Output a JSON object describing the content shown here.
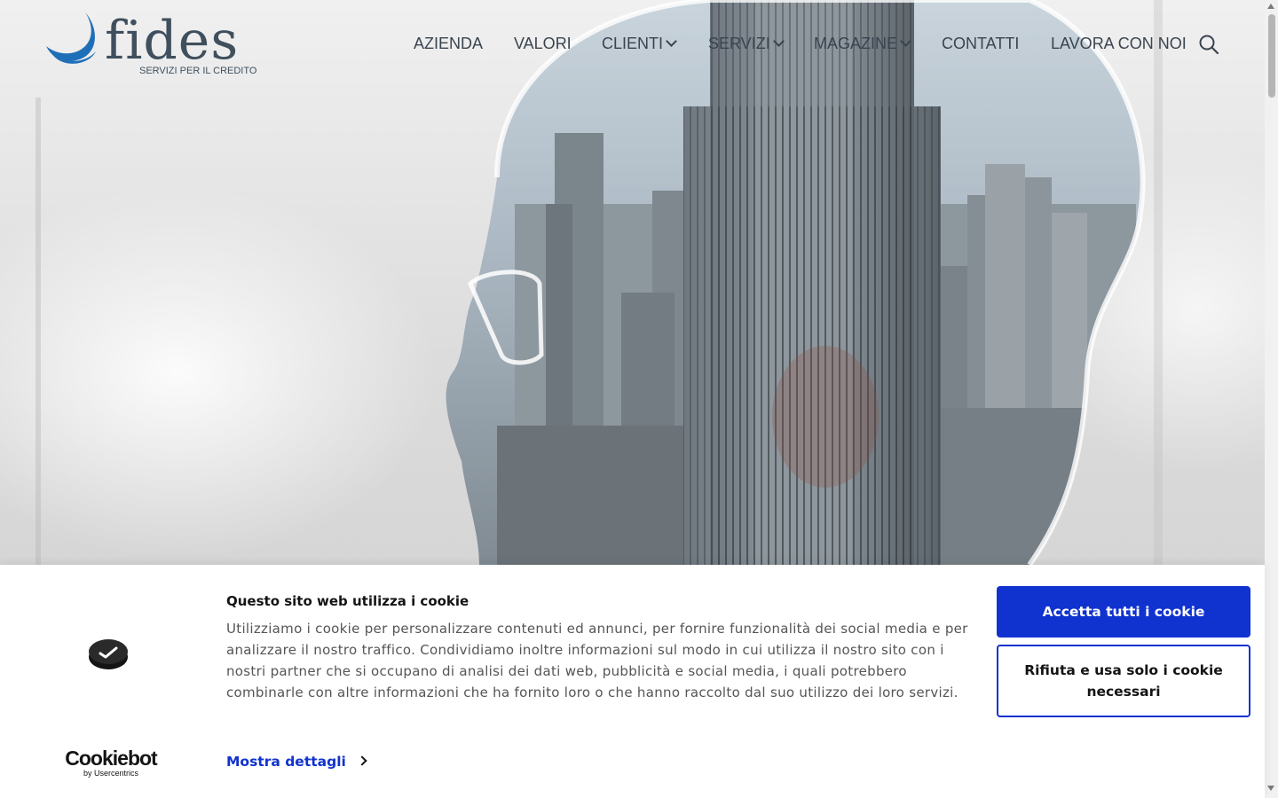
{
  "logo": {
    "word": "fides",
    "tagline": "SERVIZI PER IL CREDITO"
  },
  "nav": {
    "items": [
      {
        "label": "AZIENDA",
        "dropdown": false
      },
      {
        "label": "VALORI",
        "dropdown": false
      },
      {
        "label": "CLIENTI",
        "dropdown": true
      },
      {
        "label": "SERVIZI",
        "dropdown": true
      },
      {
        "label": "MAGAZINE",
        "dropdown": true
      },
      {
        "label": "CONTATTI",
        "dropdown": false
      },
      {
        "label": "LAVORA CON NOI",
        "dropdown": false
      }
    ],
    "search_icon": "search-icon"
  },
  "cookie": {
    "title": "Questo sito web utilizza i cookie",
    "text": "Utilizziamo i cookie per personalizzare contenuti ed annunci, per fornire funzionalità dei social media e per analizzare il nostro traffico. Condividiamo inoltre informazioni sul modo in cui utilizza il nostro sito con i nostri partner che si occupano di analisi dei dati web, pubblicità e social media, i quali potrebbero combinarle con altre informazioni che ha fornito loro o che hanno raccolto dal suo utilizzo dei loro servizi.",
    "details_link": "Mostra dettagli",
    "accept_button": "Accetta tutti i cookie",
    "reject_button": "Rifiuta e usa solo i cookie necessari",
    "brand": "Cookiebot",
    "brand_sub": "by Usercentrics"
  },
  "colors": {
    "accent_blue": "#1032cf",
    "logo_blue": "#1f6fb8",
    "logo_text": "#3f4f5d"
  }
}
